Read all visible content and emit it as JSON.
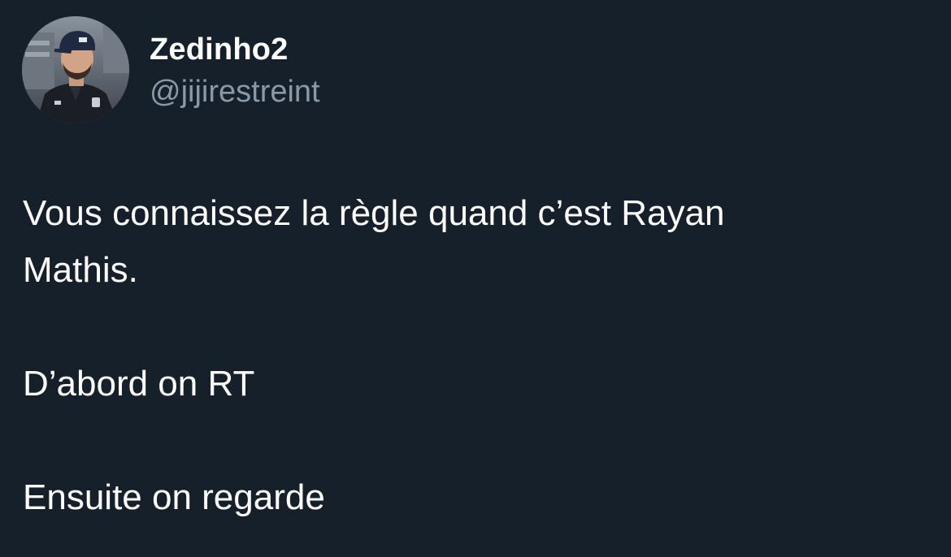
{
  "author": {
    "display_name": "Zedinho2",
    "handle": "@jijirestreint",
    "avatar_icon": "profile-photo"
  },
  "tweet": {
    "lines": [
      "Vous connaissez la règle quand c’est Rayan",
      "Mathis.",
      "D’abord on RT",
      "Ensuite on regarde"
    ]
  },
  "colors": {
    "background": "#15202b",
    "text": "#ffffff",
    "secondary_text": "#8b98a5"
  }
}
